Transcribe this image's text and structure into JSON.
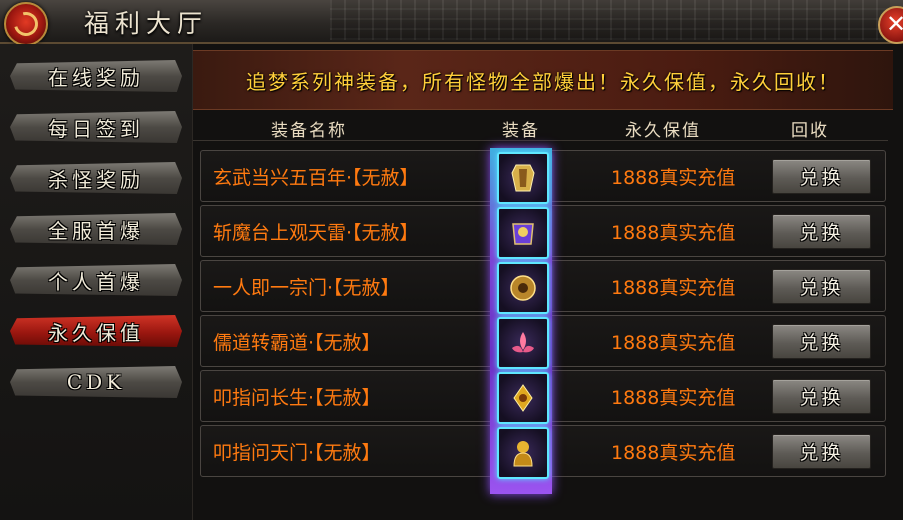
{
  "window": {
    "title": "福利大厅",
    "close_label": "✕"
  },
  "sidebar": {
    "items": [
      {
        "label": "在线奖励",
        "active": false
      },
      {
        "label": "每日签到",
        "active": false
      },
      {
        "label": "杀怪奖励",
        "active": false
      },
      {
        "label": "全服首爆",
        "active": false
      },
      {
        "label": "个人首爆",
        "active": false
      },
      {
        "label": "永久保值",
        "active": true
      },
      {
        "label": "CDK",
        "active": false
      }
    ]
  },
  "banner": {
    "text": "追梦系列神装备，所有怪物全部爆出！永久保值，永久回收！"
  },
  "table": {
    "headers": {
      "name": "装备名称",
      "equip": "装备",
      "value": "永久保值",
      "recycle": "回收"
    },
    "rows": [
      {
        "name": "玄武当兴五百年·【无赦】",
        "value": "1888真实充值",
        "button": "兑换",
        "icon": "armor-icon"
      },
      {
        "name": "斩魔台上观天雷·【无赦】",
        "value": "1888真实充值",
        "button": "兑换",
        "icon": "armor-icon"
      },
      {
        "name": "一人即一宗门·【无赦】",
        "value": "1888真实充值",
        "button": "兑换",
        "icon": "helmet-icon"
      },
      {
        "name": "儒道转霸道·【无赦】",
        "value": "1888真实充值",
        "button": "兑换",
        "icon": "lotus-icon"
      },
      {
        "name": "叩指问长生·【无赦】",
        "value": "1888真实充值",
        "button": "兑换",
        "icon": "amulet-icon"
      },
      {
        "name": "叩指问天门·【无赦】",
        "value": "1888真实充值",
        "button": "兑换",
        "icon": "statue-icon"
      }
    ]
  },
  "colors": {
    "accent": "#ff7a10",
    "banner_text": "#ffcf3a",
    "active_tab": "#b8231a",
    "slot_glow": "#5fe7ff"
  }
}
